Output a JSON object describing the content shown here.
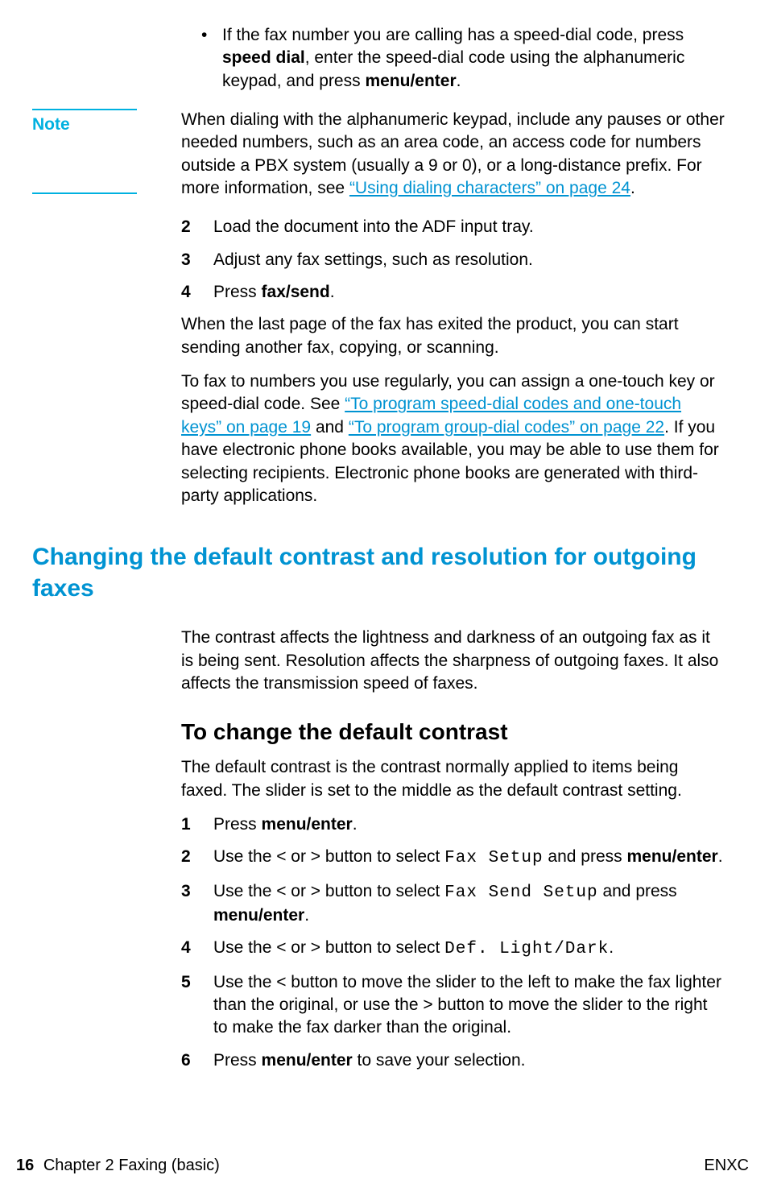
{
  "bullet1_a": "If the fax number you are calling has a speed-dial code, press ",
  "bullet1_b": "speed dial",
  "bullet1_c": ", enter the speed-dial code using the alphanumeric keypad, and press ",
  "bullet1_d": "menu/enter",
  "bullet1_e": ".",
  "bullet_char": "•",
  "note_label": "Note",
  "note_a": "When dialing with the alphanumeric keypad, include any pauses or other needed numbers, such as an area code, an access code for numbers outside a PBX system (usually a 9 or 0), or a long-distance prefix. For more information, see ",
  "note_link": "“Using dialing characters” on page 24",
  "note_b": ".",
  "s2n": "2",
  "s2t": "Load the document into the ADF input tray.",
  "s3n": "3",
  "s3t": "Adjust any fax settings, such as resolution.",
  "s4n": "4",
  "s4a": "Press ",
  "s4b": "fax/send",
  "s4c": ".",
  "p1": "When the last page of the fax has exited the product, you can start sending another fax, copying, or scanning.",
  "p2a": "To fax to numbers you use regularly, you can assign a one-touch key or speed-dial code. See ",
  "p2l1": "“To program speed-dial codes and one-touch keys” on page 19",
  "p2b": " and ",
  "p2l2": "“To program group-dial codes” on page 22",
  "p2c": ". If you have electronic phone books available, you may be able to use them for selecting recipients. Electronic phone books are generated with third-party applications.",
  "h1": "Changing the default contrast and resolution for outgoing faxes",
  "p3": "The contrast affects the lightness and darkness of an outgoing fax as it is being sent. Resolution affects the sharpness of outgoing faxes. It also affects the transmission speed of faxes.",
  "h2": "To change the default contrast",
  "p4": "The default contrast is the contrast normally applied to items being faxed. The slider is set to the middle as the default contrast setting.",
  "c1n": "1",
  "c1a": "Press ",
  "c1b": "menu/enter",
  "c1c": ".",
  "c2n": "2",
  "c2a": "Use the < or > button to select ",
  "c2m": "Fax Setup",
  "c2b": " and press ",
  "c2c": "menu/enter",
  "c2d": ".",
  "c3n": "3",
  "c3a": "Use the < or > button to select ",
  "c3m": "Fax Send Setup",
  "c3b": " and press ",
  "c3c": "menu/enter",
  "c3d": ".",
  "c4n": "4",
  "c4a": "Use the < or > button to select ",
  "c4m": "Def. Light/Dark",
  "c4b": ".",
  "c5n": "5",
  "c5a": "Use the < button to move the slider to the left to make the fax lighter than the original, or use the > button to move the slider to the right to make the fax darker than the original.",
  "c6n": "6",
  "c6a": "Press ",
  "c6b": "menu/enter",
  "c6c": " to save your selection.",
  "footer_page": "16",
  "footer_left": "Chapter 2 Faxing (basic)",
  "footer_right": "ENXC"
}
